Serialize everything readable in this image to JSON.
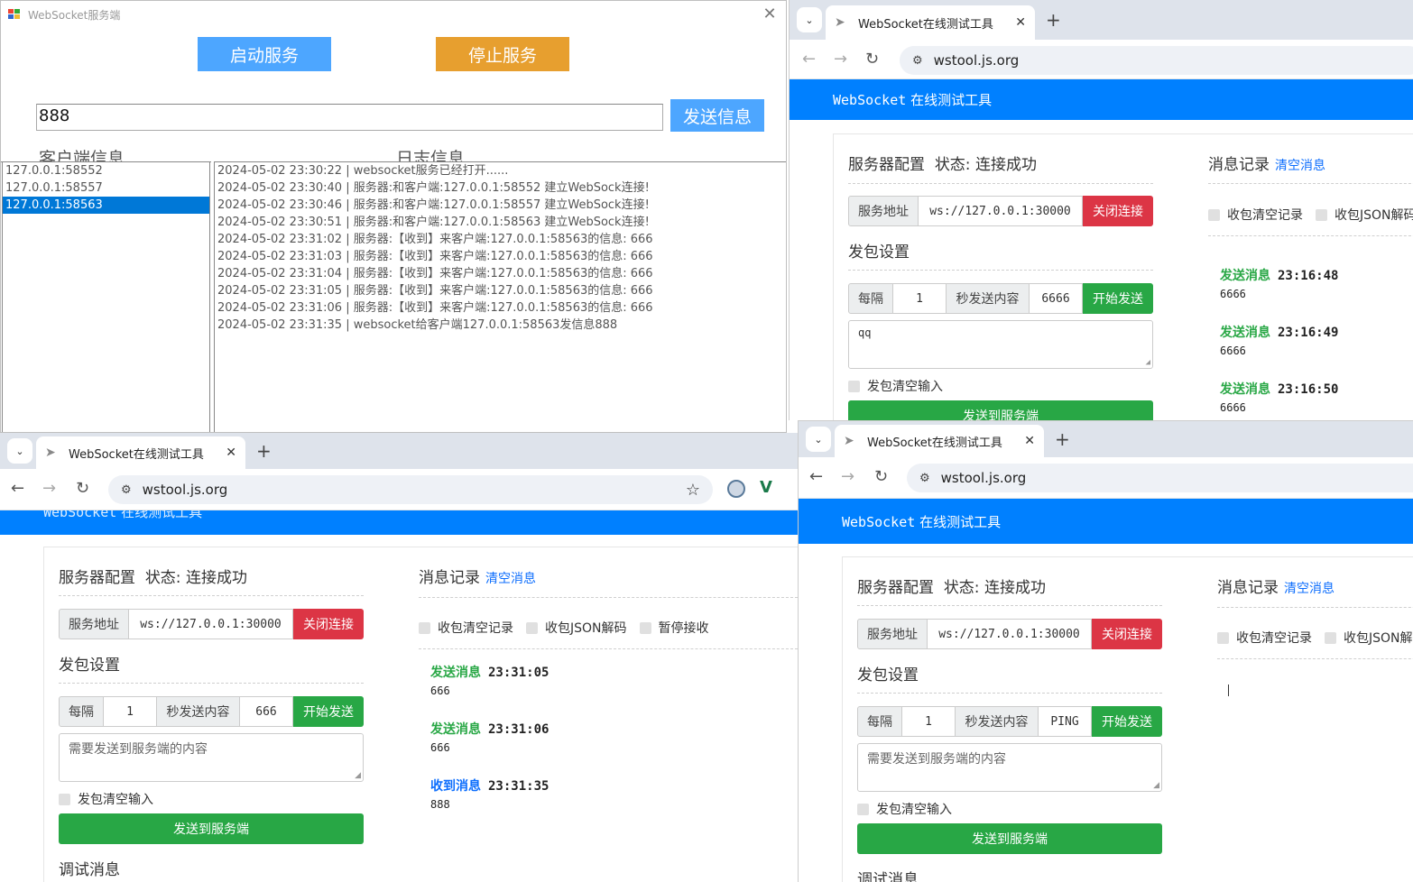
{
  "server": {
    "title": "WebSocket服务端",
    "start_label": "启动服务",
    "stop_label": "停止服务",
    "message_value": "888",
    "send_label": "发送信息",
    "clients_legend": "客户端信息",
    "log_legend": "日志信息",
    "clients": [
      "127.0.0.1:58552",
      "127.0.0.1:58557",
      "127.0.0.1:58563"
    ],
    "selected_client": "127.0.0.1:58563",
    "logs": [
      "2024-05-02 23:30:22 | websocket服务已经打开......",
      "2024-05-02 23:30:40 | 服务器:和客户端:127.0.0.1:58552 建立WebSock连接!",
      "2024-05-02 23:30:46 | 服务器:和客户端:127.0.0.1:58557 建立WebSock连接!",
      "2024-05-02 23:30:51 | 服务器:和客户端:127.0.0.1:58563 建立WebSock连接!",
      "2024-05-02 23:31:02 | 服务器:【收到】来客户端:127.0.0.1:58563的信息: 666",
      "2024-05-02 23:31:03 | 服务器:【收到】来客户端:127.0.0.1:58563的信息: 666",
      "2024-05-02 23:31:04 | 服务器:【收到】来客户端:127.0.0.1:58563的信息: 666",
      "2024-05-02 23:31:05 | 服务器:【收到】来客户端:127.0.0.1:58563的信息: 666",
      "2024-05-02 23:31:06 | 服务器:【收到】来客户端:127.0.0.1:58563的信息: 666",
      "2024-05-02 23:31:35 | websocket给客户端127.0.0.1:58563发信息888"
    ],
    "colors": {
      "start": "#4da6ff",
      "stop": "#e79f2f",
      "send": "#4da6ff"
    }
  },
  "common": {
    "tab_title": "WebSocket在线测试工具",
    "url": "wstool.js.org",
    "brand_en": "WebSocket",
    "brand_cn": "在线测试工具",
    "server_config": "服务器配置",
    "status": "状态: 连接成功",
    "server_addr_label": "服务地址",
    "server_addr_value": "ws://127.0.0.1:30000",
    "close_conn": "关闭连接",
    "packet_settings": "发包设置",
    "every": "每隔",
    "interval": "1",
    "sec_send_content": "秒发送内容",
    "start_send": "开始发送",
    "textarea_placeholder": "需要发送到服务端的内容",
    "clear_input": "发包清空输入",
    "send_to_server": "发送到服务端",
    "debug_msgs": "调试消息",
    "msg_log": "消息记录",
    "clear_msgs": "清空消息",
    "clear_on_recv": "收包清空记录",
    "json_decode": "收包JSON解码",
    "pause_recv": "暂停接收",
    "send_msg": "发送消息",
    "recv_msg": "收到消息",
    "colors": {
      "header_blue": "#0080ff",
      "success": "#28a745",
      "danger": "#dc3545",
      "link": "#0d6efd"
    }
  },
  "browserTR": {
    "send_content": "6666",
    "textarea_value": "qq",
    "messages": [
      {
        "kind": "发送消息",
        "time": "23:16:48",
        "value": "6666"
      },
      {
        "kind": "发送消息",
        "time": "23:16:49",
        "value": "6666"
      },
      {
        "kind": "发送消息",
        "time": "23:16:50",
        "value": "6666"
      }
    ]
  },
  "browserBL": {
    "send_content": "666",
    "messages": [
      {
        "kind": "发送消息",
        "time": "23:31:05",
        "value": "666"
      },
      {
        "kind": "发送消息",
        "time": "23:31:06",
        "value": "666"
      },
      {
        "kind": "收到消息",
        "time": "23:31:35",
        "value": "888"
      }
    ]
  },
  "browserBR": {
    "send_content": "PING"
  }
}
